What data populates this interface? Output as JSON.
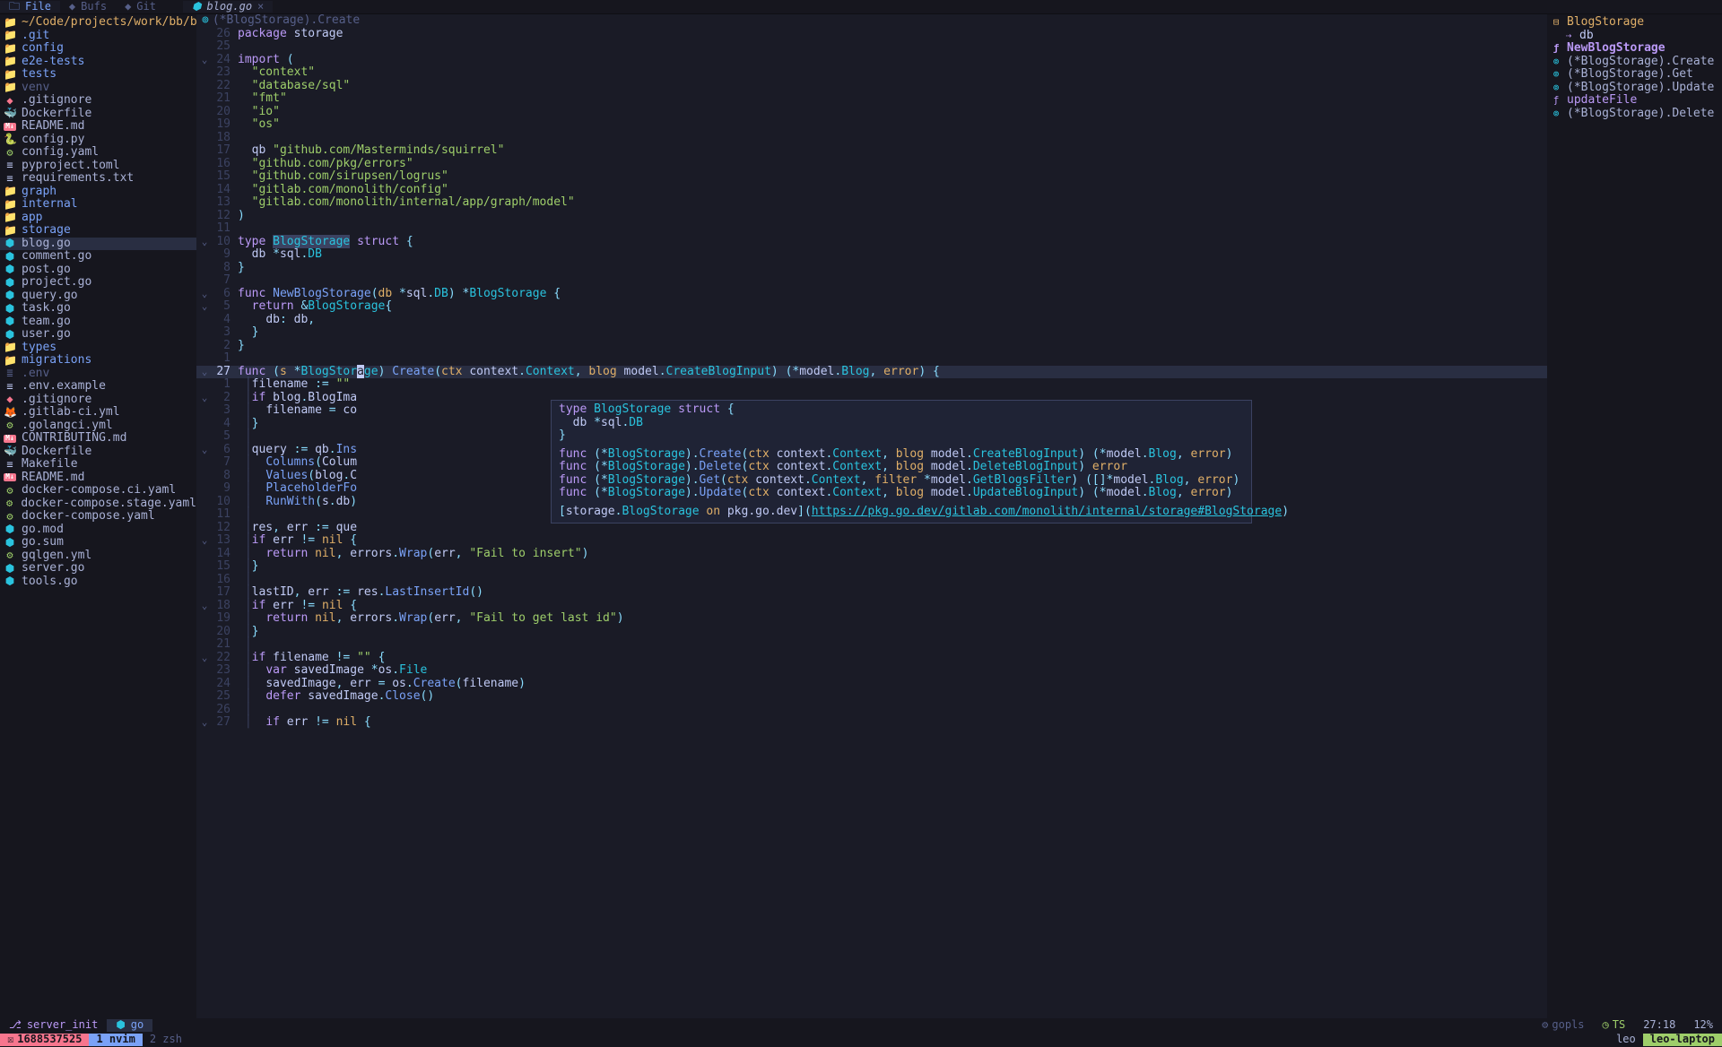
{
  "topbar": {
    "side_tabs": [
      {
        "label": "File",
        "active": true
      },
      {
        "label": "Bufs",
        "active": false
      },
      {
        "label": "Git",
        "active": false
      }
    ],
    "editor_tabs": [
      {
        "label": "blog.go",
        "modified": false
      }
    ]
  },
  "filetree": {
    "cwd": "~/Code/projects/work/bb/bac",
    "items": [
      {
        "l": 0,
        "t": "folder",
        "n": ".git"
      },
      {
        "l": 0,
        "t": "folder",
        "n": "config"
      },
      {
        "l": 0,
        "t": "folder",
        "n": "e2e-tests"
      },
      {
        "l": 1,
        "t": "folder",
        "n": "tests"
      },
      {
        "l": 1,
        "t": "folder-dim",
        "n": "venv"
      },
      {
        "l": 1,
        "t": "git",
        "n": ".gitignore"
      },
      {
        "l": 1,
        "t": "docker",
        "n": "Dockerfile"
      },
      {
        "l": 1,
        "t": "md",
        "n": "README.md"
      },
      {
        "l": 1,
        "t": "py",
        "n": "config.py"
      },
      {
        "l": 1,
        "t": "yaml",
        "n": "config.yaml"
      },
      {
        "l": 1,
        "t": "txt",
        "n": "pyproject.toml"
      },
      {
        "l": 1,
        "t": "txt",
        "n": "requirements.txt"
      },
      {
        "l": 0,
        "t": "folder",
        "n": "graph"
      },
      {
        "l": 0,
        "t": "folder",
        "n": "internal"
      },
      {
        "l": 1,
        "t": "folder",
        "n": "app"
      },
      {
        "l": 1,
        "t": "folder",
        "n": "storage",
        "open": true
      },
      {
        "l": 3,
        "t": "go",
        "n": "blog.go",
        "sel": true
      },
      {
        "l": 3,
        "t": "go",
        "n": "comment.go"
      },
      {
        "l": 3,
        "t": "go",
        "n": "post.go"
      },
      {
        "l": 3,
        "t": "go",
        "n": "project.go"
      },
      {
        "l": 3,
        "t": "go",
        "n": "query.go"
      },
      {
        "l": 3,
        "t": "go",
        "n": "task.go"
      },
      {
        "l": 3,
        "t": "go",
        "n": "team.go"
      },
      {
        "l": 3,
        "t": "go",
        "n": "user.go"
      },
      {
        "l": 1,
        "t": "folder",
        "n": "types"
      },
      {
        "l": 0,
        "t": "folder",
        "n": "migrations"
      },
      {
        "l": 0,
        "t": "env",
        "n": ".env"
      },
      {
        "l": 0,
        "t": "txt",
        "n": ".env.example"
      },
      {
        "l": 0,
        "t": "git",
        "n": ".gitignore"
      },
      {
        "l": 0,
        "t": "git-ci",
        "n": ".gitlab-ci.yml"
      },
      {
        "l": 0,
        "t": "yaml",
        "n": ".golangci.yml"
      },
      {
        "l": 0,
        "t": "md",
        "n": "CONTRIBUTING.md"
      },
      {
        "l": 0,
        "t": "docker",
        "n": "Dockerfile"
      },
      {
        "l": 0,
        "t": "txt",
        "n": "Makefile"
      },
      {
        "l": 0,
        "t": "md",
        "n": "README.md"
      },
      {
        "l": 0,
        "t": "yaml",
        "n": "docker-compose.ci.yaml"
      },
      {
        "l": 0,
        "t": "yaml",
        "n": "docker-compose.stage.yaml"
      },
      {
        "l": 0,
        "t": "yaml",
        "n": "docker-compose.yaml"
      },
      {
        "l": 0,
        "t": "go",
        "n": "go.mod"
      },
      {
        "l": 0,
        "t": "go",
        "n": "go.sum"
      },
      {
        "l": 0,
        "t": "yaml",
        "n": "gqlgen.yml"
      },
      {
        "l": 0,
        "t": "go",
        "n": "server.go"
      },
      {
        "l": 0,
        "t": "go",
        "n": "tools.go"
      }
    ]
  },
  "breadcrumb": {
    "icon": "ƒ",
    "path": "(*BlogStorage).Create"
  },
  "code": [
    {
      "f": "",
      "n": "26",
      "h": "<span class='kw'>package</span> <span class='pkg'>storage</span>"
    },
    {
      "f": "",
      "n": "25",
      "h": ""
    },
    {
      "f": "⌄",
      "n": "24",
      "h": "<span class='kw'>import</span> <span class='op'>(</span>"
    },
    {
      "f": "",
      "n": "23",
      "h": "  <span class='str'>\"context\"</span>"
    },
    {
      "f": "",
      "n": "22",
      "h": "  <span class='str'>\"database/sql\"</span>"
    },
    {
      "f": "",
      "n": "21",
      "h": "  <span class='str'>\"fmt\"</span>"
    },
    {
      "f": "",
      "n": "20",
      "h": "  <span class='str'>\"io\"</span>"
    },
    {
      "f": "",
      "n": "19",
      "h": "  <span class='str'>\"os\"</span>"
    },
    {
      "f": "",
      "n": "18",
      "h": ""
    },
    {
      "f": "",
      "n": "17",
      "h": "  <span class='id'>qb</span> <span class='str'>\"github.com/Masterminds/squirrel\"</span>"
    },
    {
      "f": "",
      "n": "16",
      "h": "  <span class='str'>\"github.com/pkg/errors\"</span>"
    },
    {
      "f": "",
      "n": "15",
      "h": "  <span class='str'>\"github.com/sirupsen/logrus\"</span>"
    },
    {
      "f": "",
      "n": "14",
      "h": "  <span class='str'>\"gitlab.com/monolith/config\"</span>"
    },
    {
      "f": "",
      "n": "13",
      "h": "  <span class='str'>\"gitlab.com/monolith/internal/app/graph/model\"</span>"
    },
    {
      "f": "",
      "n": "12",
      "h": "<span class='op'>)</span>"
    },
    {
      "f": "",
      "n": "11",
      "h": ""
    },
    {
      "f": "⌄",
      "n": "10",
      "h": "<span class='kw'>type</span> <span class='typ' style='background:#3b4261'>BlogStorage</span> <span class='kw'>struct</span> <span class='op'>{</span>"
    },
    {
      "f": "",
      "n": "9",
      "h": "  <span class='id'>db</span> <span class='op'>*</span><span class='pkg'>sql</span><span class='dot'>.</span><span class='typ'>DB</span>"
    },
    {
      "f": "",
      "n": "8",
      "h": "<span class='op'>}</span>"
    },
    {
      "f": "",
      "n": "7",
      "h": ""
    },
    {
      "f": "⌄",
      "n": "6",
      "h": "<span class='kw'>func</span> <span class='fn'>NewBlogStorage</span><span class='op'>(</span><span class='prm'>db</span> <span class='op'>*</span><span class='pkg'>sql</span><span class='dot'>.</span><span class='typ'>DB</span><span class='op'>)</span> <span class='op'>*</span><span class='typ'>BlogStorage</span> <span class='op'>{</span>"
    },
    {
      "f": "⌄",
      "n": "5",
      "h": "  <span class='kw'>return</span> <span class='op'>&amp;</span><span class='typ'>BlogStorage</span><span class='op'>{</span>"
    },
    {
      "f": "",
      "n": "4",
      "h": "    <span class='id'>db</span><span class='op'>:</span> <span class='id'>db</span><span class='op'>,</span>"
    },
    {
      "f": "",
      "n": "3",
      "h": "  <span class='op'>}</span>"
    },
    {
      "f": "",
      "n": "2",
      "h": "<span class='op'>}</span>"
    },
    {
      "f": "",
      "n": "1",
      "h": ""
    },
    {
      "f": "⌄",
      "n": "27",
      "hl": true,
      "h": "<span class='kw'>func</span> <span class='op'>(</span><span class='prm'>s</span> <span class='op'>*</span><span class='typ'>BlogStor</span><span class='cursor'>a</span><span class='typ'>ge</span><span class='op'>)</span> <span class='fn'>Create</span><span class='op'>(</span><span class='prm'>ctx</span> <span class='pkg'>context</span><span class='dot'>.</span><span class='typ'>Context</span><span class='op'>,</span> <span class='prm'>blog</span> <span class='pkg'>model</span><span class='dot'>.</span><span class='typ'>CreateBlogInput</span><span class='op'>)</span> <span class='op'>(*</span><span class='pkg'>model</span><span class='dot'>.</span><span class='typ'>Blog</span><span class='op'>,</span> <span class='builtin'>error</span><span class='op'>)</span> <span class='op'>{</span>"
    },
    {
      "f": "",
      "n": "1",
      "h": " <span style='color:#3b4261'>│</span><span class='id'>filename</span> <span class='op'>:=</span> <span class='str'>\"\"</span>"
    },
    {
      "f": "⌄",
      "n": "2",
      "h": " <span style='color:#3b4261'>│</span><span class='kw'>if</span> <span class='id'>blog</span><span class='dot'>.</span><span class='id'>BlogIma</span>"
    },
    {
      "f": "",
      "n": "3",
      "h": " <span style='color:#3b4261'>│</span>  <span class='id'>filename</span> <span class='op'>=</span> <span class='id'>co</span>"
    },
    {
      "f": "",
      "n": "4",
      "h": " <span style='color:#3b4261'>│</span><span class='op'>}</span>"
    },
    {
      "f": "",
      "n": "5",
      "h": " <span style='color:#3b4261'>│</span>"
    },
    {
      "f": "⌄",
      "n": "6",
      "h": " <span style='color:#3b4261'>│</span><span class='id'>query</span> <span class='op'>:=</span> <span class='pkg'>qb</span><span class='dot'>.</span><span class='fn'>Ins</span>"
    },
    {
      "f": "",
      "n": "7",
      "h": " <span style='color:#3b4261'>│</span>  <span class='fn'>Columns</span><span class='op'>(</span><span class='id'>Colum</span>"
    },
    {
      "f": "",
      "n": "8",
      "h": " <span style='color:#3b4261'>│</span>  <span class='fn'>Values</span><span class='op'>(</span><span class='id'>blog</span><span class='dot'>.</span><span class='id'>C</span>"
    },
    {
      "f": "",
      "n": "9",
      "h": " <span style='color:#3b4261'>│</span>  <span class='fn'>PlaceholderFo</span>"
    },
    {
      "f": "",
      "n": "10",
      "h": " <span style='color:#3b4261'>│</span>  <span class='fn'>RunWith</span><span class='op'>(</span><span class='id'>s</span><span class='dot'>.</span><span class='id'>db</span><span class='op'>)</span>"
    },
    {
      "f": "",
      "n": "11",
      "h": " <span style='color:#3b4261'>│</span>"
    },
    {
      "f": "",
      "n": "12",
      "h": " <span style='color:#3b4261'>│</span><span class='id'>res</span><span class='op'>,</span> <span class='id'>err</span> <span class='op'>:=</span> <span class='id'>que</span>"
    },
    {
      "f": "⌄",
      "n": "13",
      "h": " <span style='color:#3b4261'>│</span><span class='kw'>if</span> <span class='id'>err</span> <span class='op'>!=</span> <span class='builtin'>nil</span> <span class='op'>{</span>"
    },
    {
      "f": "",
      "n": "14",
      "h": " <span style='color:#3b4261'>│</span>  <span class='kw'>return</span> <span class='builtin'>nil</span><span class='op'>,</span> <span class='pkg'>errors</span><span class='dot'>.</span><span class='fn'>Wrap</span><span class='op'>(</span><span class='id'>err</span><span class='op'>,</span> <span class='str'>\"Fail to insert\"</span><span class='op'>)</span>"
    },
    {
      "f": "",
      "n": "15",
      "h": " <span style='color:#3b4261'>│</span><span class='op'>}</span>"
    },
    {
      "f": "",
      "n": "16",
      "h": " <span style='color:#3b4261'>│</span>"
    },
    {
      "f": "",
      "n": "17",
      "h": " <span style='color:#3b4261'>│</span><span class='id'>lastID</span><span class='op'>,</span> <span class='id'>err</span> <span class='op'>:=</span> <span class='id'>res</span><span class='dot'>.</span><span class='fn'>LastInsertId</span><span class='op'>()</span>"
    },
    {
      "f": "⌄",
      "n": "18",
      "h": " <span style='color:#3b4261'>│</span><span class='kw'>if</span> <span class='id'>err</span> <span class='op'>!=</span> <span class='builtin'>nil</span> <span class='op'>{</span>"
    },
    {
      "f": "",
      "n": "19",
      "h": " <span style='color:#3b4261'>│</span>  <span class='kw'>return</span> <span class='builtin'>nil</span><span class='op'>,</span> <span class='pkg'>errors</span><span class='dot'>.</span><span class='fn'>Wrap</span><span class='op'>(</span><span class='id'>err</span><span class='op'>,</span> <span class='str'>\"Fail to get last id\"</span><span class='op'>)</span>"
    },
    {
      "f": "",
      "n": "20",
      "h": " <span style='color:#3b4261'>│</span><span class='op'>}</span>"
    },
    {
      "f": "",
      "n": "21",
      "h": " <span style='color:#3b4261'>│</span>"
    },
    {
      "f": "⌄",
      "n": "22",
      "h": " <span style='color:#3b4261'>│</span><span class='kw'>if</span> <span class='id'>filename</span> <span class='op'>!=</span> <span class='str'>\"\"</span> <span class='op'>{</span>"
    },
    {
      "f": "",
      "n": "23",
      "h": " <span style='color:#3b4261'>│</span>  <span class='kw'>var</span> <span class='id'>savedImage</span> <span class='op'>*</span><span class='pkg'>os</span><span class='dot'>.</span><span class='typ'>File</span>"
    },
    {
      "f": "",
      "n": "24",
      "h": " <span style='color:#3b4261'>│</span>  <span class='id'>savedImage</span><span class='op'>,</span> <span class='id'>err</span> <span class='op'>=</span> <span class='pkg'>os</span><span class='dot'>.</span><span class='fn'>Create</span><span class='op'>(</span><span class='id'>filename</span><span class='op'>)</span>"
    },
    {
      "f": "",
      "n": "25",
      "h": " <span style='color:#3b4261'>│</span>  <span class='kw'>defer</span> <span class='id'>savedImage</span><span class='dot'>.</span><span class='fn'>Close</span><span class='op'>()</span>"
    },
    {
      "f": "",
      "n": "26",
      "h": " <span style='color:#3b4261'>│</span>"
    },
    {
      "f": "⌄",
      "n": "27",
      "h": " <span style='color:#3b4261'>│</span>  <span class='kw'>if</span> <span class='id'>err</span> <span class='op'>!=</span> <span class='builtin'>nil</span> <span class='op'>{</span>"
    }
  ],
  "hover": {
    "lines": [
      "<span class='kw'>type</span> <span class='typ'>BlogStorage</span> <span class='kw'>struct</span> <span class='op'>{</span>",
      "  <span class='id'>db</span> <span class='op'>*</span><span class='pkg'>sql</span><span class='dot'>.</span><span class='typ'>DB</span>",
      "<span class='op'>}</span>",
      "",
      "<span class='kw'>func</span> <span class='op'>(*</span><span class='typ'>BlogStorage</span><span class='op'>).</span><span class='fn'>Create</span><span class='op'>(</span><span class='prm'>ctx</span> <span class='pkg'>context</span><span class='dot'>.</span><span class='typ'>Context</span><span class='op'>,</span> <span class='prm'>blog</span> <span class='pkg'>model</span><span class='dot'>.</span><span class='typ'>CreateBlogInput</span><span class='op'>)</span> <span class='op'>(*</span><span class='pkg'>model</span><span class='dot'>.</span><span class='typ'>Blog</span><span class='op'>,</span> <span class='builtin'>error</span><span class='op'>)</span>",
      "<span class='kw'>func</span> <span class='op'>(*</span><span class='typ'>BlogStorage</span><span class='op'>).</span><span class='fn'>Delete</span><span class='op'>(</span><span class='prm'>ctx</span> <span class='pkg'>context</span><span class='dot'>.</span><span class='typ'>Context</span><span class='op'>,</span> <span class='prm'>blog</span> <span class='pkg'>model</span><span class='dot'>.</span><span class='typ'>DeleteBlogInput</span><span class='op'>)</span> <span class='builtin'>error</span>",
      "<span class='kw'>func</span> <span class='op'>(*</span><span class='typ'>BlogStorage</span><span class='op'>).</span><span class='fn'>Get</span><span class='op'>(</span><span class='prm'>ctx</span> <span class='pkg'>context</span><span class='dot'>.</span><span class='typ'>Context</span><span class='op'>,</span> <span class='prm'>filter</span> <span class='op'>*</span><span class='pkg'>model</span><span class='dot'>.</span><span class='typ'>GetBlogsFilter</span><span class='op'>)</span> <span class='op'>([]*</span><span class='pkg'>model</span><span class='dot'>.</span><span class='typ'>Blog</span><span class='op'>,</span> <span class='builtin'>error</span><span class='op'>)</span>",
      "<span class='kw'>func</span> <span class='op'>(*</span><span class='typ'>BlogStorage</span><span class='op'>).</span><span class='fn'>Update</span><span class='op'>(</span><span class='prm'>ctx</span> <span class='pkg'>context</span><span class='dot'>.</span><span class='typ'>Context</span><span class='op'>,</span> <span class='prm'>blog</span> <span class='pkg'>model</span><span class='dot'>.</span><span class='typ'>UpdateBlogInput</span><span class='op'>)</span> <span class='op'>(*</span><span class='pkg'>model</span><span class='dot'>.</span><span class='typ'>Blog</span><span class='op'>,</span> <span class='builtin'>error</span><span class='op'>)</span>",
      "",
      "<span class='op'>[</span><span class='pkg'>storage</span><span class='dot'>.</span><span class='typ'>BlogStorage</span> <span class='builtin'>on</span> <span class='pkg'>pkg.go.dev</span><span class='op'>](</span><span class='link'>https://pkg.go.dev/gitlab.com/monolith/internal/storage#BlogStorage</span><span class='op'>)</span>"
    ]
  },
  "outline": [
    {
      "t": "struct",
      "n": "BlogStorage",
      "l": 0
    },
    {
      "t": "field",
      "n": "db",
      "l": 1
    },
    {
      "t": "func",
      "n": "NewBlogStorage",
      "l": 0,
      "sel": true
    },
    {
      "t": "method",
      "n": "(*BlogStorage).Create",
      "l": 0
    },
    {
      "t": "method",
      "n": "(*BlogStorage).Get",
      "l": 0
    },
    {
      "t": "method",
      "n": "(*BlogStorage).Update",
      "l": 0
    },
    {
      "t": "func",
      "n": "updateFile",
      "l": 0
    },
    {
      "t": "method",
      "n": "(*BlogStorage).Delete",
      "l": 0
    }
  ],
  "midstatus": {
    "branch": "server_init",
    "lang": "go",
    "lsp": "gopls",
    "ts": "TS",
    "pos": "27:18",
    "pct": "12%"
  },
  "tmux": {
    "err_count": "1688537525",
    "windows": [
      {
        "idx": "1",
        "name": "nvim",
        "active": true
      },
      {
        "idx": "2",
        "name": "zsh",
        "active": false
      }
    ],
    "user": "leo",
    "host": "leo-laptop"
  }
}
